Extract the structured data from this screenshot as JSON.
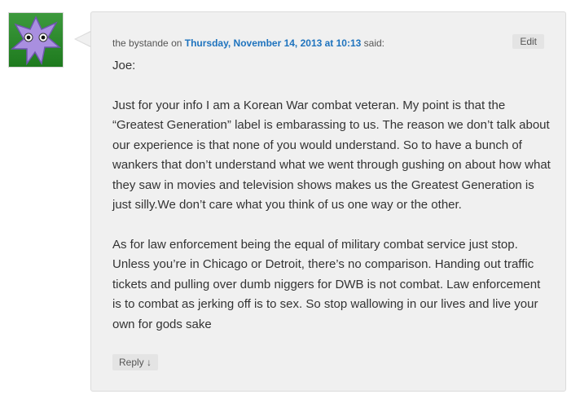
{
  "comment": {
    "author": "the bystande",
    "on_text": "on",
    "date_link": "Thursday, November 14, 2013 at 10:13",
    "said_text": "said:",
    "edit_label": "Edit",
    "reply_label": "Reply ↓",
    "paragraphs": [
      "Joe:",
      "Just for your info I am a Korean War combat veteran. My point is that the “Greatest Generation” label is embarassing to us. The reason we don’t talk about our experience is that none of you would understand. So to have a bunch of wankers that don’t understand what we went through gushing on about how what they saw in movies and television shows makes us the Greatest Generation is just silly.We don’t care what you think of us one way or the other.",
      "As for law enforcement being the equal of military combat service just stop. Unless you’re in Chicago or Detroit, there’s no comparison. Handing out traffic tickets and pulling over dumb niggers for DWB is not combat. Law enforcement is to combat as jerking off is to sex. So stop wallowing in our lives and live your own for gods sake"
    ]
  },
  "colors": {
    "link": "#1e73be",
    "bubble_bg": "#f0f0f0",
    "avatar_bg": "#2e8b2e",
    "avatar_star": "#a98fe0"
  },
  "icons": {
    "avatar": "purple-star-monster-icon"
  }
}
